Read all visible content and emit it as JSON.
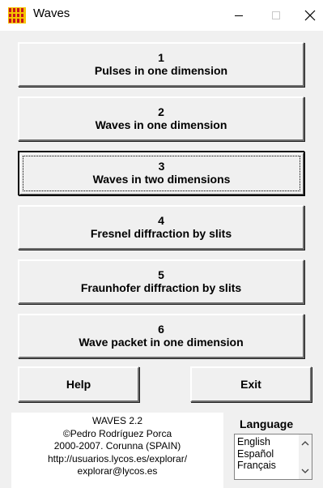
{
  "window": {
    "title": "Waves",
    "icon": "waves-app-icon"
  },
  "titlebar_controls": {
    "minimize_icon": "minimize-icon",
    "maximize_icon": "maximize-icon",
    "close_icon": "close-icon"
  },
  "menu": {
    "items": [
      {
        "number": "1",
        "label": "Pulses in one dimension"
      },
      {
        "number": "2",
        "label": "Waves in one dimension"
      },
      {
        "number": "3",
        "label": "Waves in two dimensions"
      },
      {
        "number": "4",
        "label": "Fresnel diffraction by slits"
      },
      {
        "number": "5",
        "label": "Fraunhofer diffraction by slits"
      },
      {
        "number": "6",
        "label": "Wave packet in one dimension"
      }
    ],
    "focused_index": 2
  },
  "actions": {
    "help_label": "Help",
    "exit_label": "Exit"
  },
  "info": {
    "lines": [
      "WAVES 2.2",
      "©Pedro Rodríguez Porca",
      "2000-2007. Corunna (SPAIN)",
      "http://usuarios.lycos.es/explorar/",
      "explorar@lycos.es"
    ]
  },
  "language": {
    "label": "Language",
    "options": [
      "English",
      "Español",
      "Français"
    ],
    "scroll_up_icon": "scroll-up-arrow-icon",
    "scroll_down_icon": "scroll-down-arrow-icon"
  },
  "colors": {
    "background": "#f0f0f0",
    "titlebar": "#ffffff",
    "icon_yellow": "#f5c400",
    "icon_red": "#c8141e"
  }
}
